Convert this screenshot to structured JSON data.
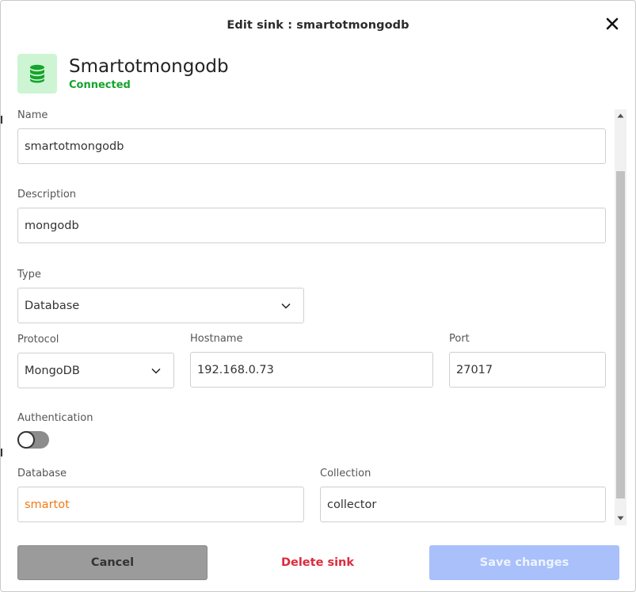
{
  "dialog": {
    "title": "Edit sink : smartotmongodb"
  },
  "header": {
    "icon": "database-icon",
    "name": "Smartotmongodb",
    "status": "Connected",
    "status_color": "#16a32c",
    "icon_bg": "#cdf5d3",
    "icon_color": "#16a32c"
  },
  "form": {
    "name": {
      "label": "Name",
      "value": "smartotmongodb"
    },
    "description": {
      "label": "Description",
      "value": "mongodb"
    },
    "type": {
      "label": "Type",
      "value": "Database"
    },
    "protocol": {
      "label": "Protocol",
      "value": "MongoDB"
    },
    "hostname": {
      "label": "Hostname",
      "value": "192.168.0.73"
    },
    "port": {
      "label": "Port",
      "value": "27017"
    },
    "authentication": {
      "label": "Authentication",
      "enabled": false
    },
    "database": {
      "label": "Database",
      "value": "smartot",
      "value_color": "#f07b12"
    },
    "collection": {
      "label": "Collection",
      "value": "collector"
    }
  },
  "actions": {
    "cancel_label": "Cancel",
    "delete_label": "Delete sink",
    "save_label": "Save changes",
    "delete_color": "#dc2b3c",
    "save_bg": "#a9c0fb"
  }
}
